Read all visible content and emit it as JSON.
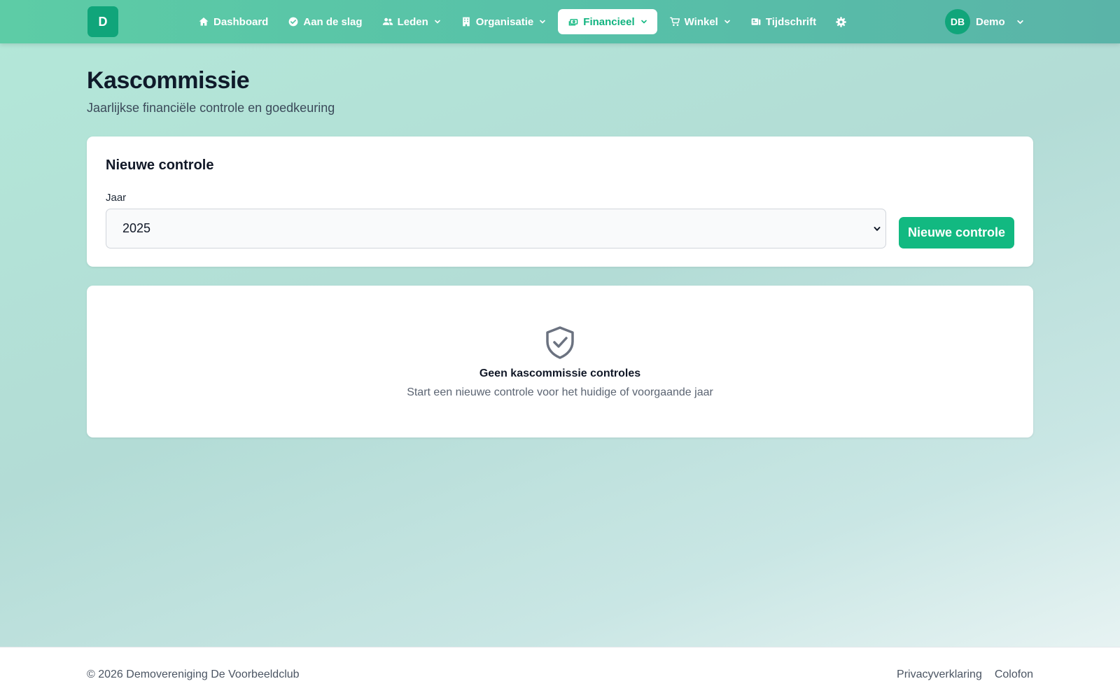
{
  "app": {
    "logo_letter": "D"
  },
  "nav": {
    "items": [
      {
        "label": "Dashboard",
        "icon": "home-icon"
      },
      {
        "label": "Aan de slag",
        "icon": "check-circle-icon"
      },
      {
        "label": "Leden",
        "icon": "users-icon"
      },
      {
        "label": "Organisatie",
        "icon": "building-icon"
      },
      {
        "label": "Financieel",
        "icon": "money-icon",
        "active": true
      },
      {
        "label": "Winkel",
        "icon": "cart-icon"
      },
      {
        "label": "Tijdschrift",
        "icon": "magazine-icon"
      }
    ],
    "settings_icon": "gear-icon"
  },
  "user": {
    "initials": "DB",
    "name": "Demo"
  },
  "header": {
    "title": "Kascommissie",
    "subtitle": "Jaarlijkse financiële controle en goedkeuring"
  },
  "new_check": {
    "title": "Nieuwe controle",
    "year_label": "Jaar",
    "year_value": "2025",
    "button_label": "Nieuwe controle"
  },
  "empty_state": {
    "icon": "shield-check-icon",
    "title": "Geen kascommissie controles",
    "description": "Start een nieuwe controle voor het huidige of voorgaande jaar"
  },
  "footer": {
    "copyright": "© 2026 Demovereniging De Voorbeeldclub",
    "links": [
      "Privacyverklaring",
      "Colofon"
    ]
  },
  "colors": {
    "accent": "#12b981",
    "nav_start": "#5dcca6",
    "nav_end": "#5ab4a8",
    "logo_bg": "#10a57a"
  }
}
